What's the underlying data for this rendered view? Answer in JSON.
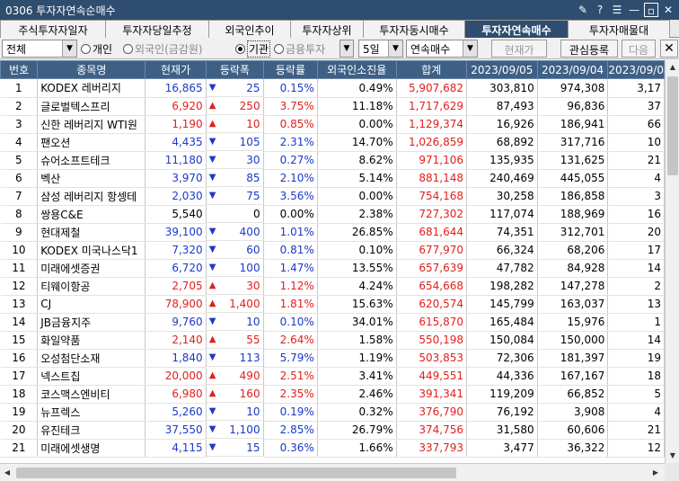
{
  "window": {
    "title": "0306 투자자연속순매수"
  },
  "tabs": [
    {
      "label": "주식투자자일자"
    },
    {
      "label": "투자자당일추정"
    },
    {
      "label": "외국인추이"
    },
    {
      "label": "투자자상위"
    },
    {
      "label": "투자자동시매수"
    },
    {
      "label": "투자자연속매수",
      "active": true
    },
    {
      "label": "투자자매물대"
    }
  ],
  "toolbar": {
    "market_select": "전체",
    "radio_individual": "개인",
    "radio_foreign": "외국인(금감원)",
    "radio_institution": "기관",
    "radio_financial": "금융투자",
    "period_select": "5일",
    "mode_select": "연속매수",
    "price_button": "현재가",
    "watch_button": "관심등록",
    "next_button": "다음",
    "close_button": "✕"
  },
  "colors": {
    "header_bg": "#3f6085",
    "up": "#e0201c",
    "down": "#1a39c9",
    "title_bg": "#2f4d6e"
  },
  "table": {
    "headers": [
      "번호",
      "종목명",
      "현재가",
      "등락폭",
      "등락률",
      "외국인소진율",
      "합계",
      "2023/09/05",
      "2023/09/04",
      "2023/09/0"
    ],
    "rows": [
      [
        "1",
        "KODEX 레버리지",
        "16,865",
        "down",
        "25",
        "0.15%",
        "0.49%",
        "5,907,682",
        "303,810",
        "974,308",
        "3,17"
      ],
      [
        "2",
        "글로벌텍스프리",
        "6,920",
        "up",
        "250",
        "3.75%",
        "11.18%",
        "1,717,629",
        "87,493",
        "96,836",
        "37"
      ],
      [
        "3",
        "신한 레버리지 WTI원",
        "1,190",
        "up",
        "10",
        "0.85%",
        "0.00%",
        "1,129,374",
        "16,926",
        "186,941",
        "66"
      ],
      [
        "4",
        "팬오션",
        "4,435",
        "down",
        "105",
        "2.31%",
        "14.70%",
        "1,026,859",
        "68,892",
        "317,716",
        "10"
      ],
      [
        "5",
        "슈어소프트테크",
        "11,180",
        "down",
        "30",
        "0.27%",
        "8.62%",
        "971,106",
        "135,935",
        "131,625",
        "21"
      ],
      [
        "6",
        "벡산",
        "3,970",
        "down",
        "85",
        "2.10%",
        "5.14%",
        "881,148",
        "240,469",
        "445,055",
        "4"
      ],
      [
        "7",
        "삼성 레버리지 항셍테",
        "2,030",
        "down",
        "75",
        "3.56%",
        "0.00%",
        "754,168",
        "30,258",
        "186,858",
        "3"
      ],
      [
        "8",
        "쌍용C&E",
        "5,540",
        "",
        "0",
        "0.00%",
        "2.38%",
        "727,302",
        "117,074",
        "188,969",
        "16"
      ],
      [
        "9",
        "현대제철",
        "39,100",
        "down",
        "400",
        "1.01%",
        "26.85%",
        "681,644",
        "74,351",
        "312,701",
        "20"
      ],
      [
        "10",
        "KODEX 미국나스닥1",
        "7,320",
        "down",
        "60",
        "0.81%",
        "0.10%",
        "677,970",
        "66,324",
        "68,206",
        "17"
      ],
      [
        "11",
        "미래에셋증권",
        "6,720",
        "down",
        "100",
        "1.47%",
        "13.55%",
        "657,639",
        "47,782",
        "84,928",
        "14"
      ],
      [
        "12",
        "티웨이항공",
        "2,705",
        "up",
        "30",
        "1.12%",
        "4.24%",
        "654,668",
        "198,282",
        "147,278",
        "2"
      ],
      [
        "13",
        "CJ",
        "78,900",
        "up",
        "1,400",
        "1.81%",
        "15.63%",
        "620,574",
        "145,799",
        "163,037",
        "13"
      ],
      [
        "14",
        "JB금융지주",
        "9,760",
        "down",
        "10",
        "0.10%",
        "34.01%",
        "615,870",
        "165,484",
        "15,976",
        "1"
      ],
      [
        "15",
        "화일약품",
        "2,140",
        "up",
        "55",
        "2.64%",
        "1.58%",
        "550,198",
        "150,084",
        "150,000",
        "14"
      ],
      [
        "16",
        "오성첨단소재",
        "1,840",
        "down",
        "113",
        "5.79%",
        "1.19%",
        "503,853",
        "72,306",
        "181,397",
        "19"
      ],
      [
        "17",
        "넥스트칩",
        "20,000",
        "up",
        "490",
        "2.51%",
        "3.41%",
        "449,551",
        "44,336",
        "167,167",
        "18"
      ],
      [
        "18",
        "코스맥스엔비티",
        "6,980",
        "up",
        "160",
        "2.35%",
        "2.46%",
        "391,341",
        "119,209",
        "66,852",
        "5"
      ],
      [
        "19",
        "뉴프렉스",
        "5,260",
        "down",
        "10",
        "0.19%",
        "0.32%",
        "376,790",
        "76,192",
        "3,908",
        "4"
      ],
      [
        "20",
        "유진테크",
        "37,550",
        "down",
        "1,100",
        "2.85%",
        "26.79%",
        "374,756",
        "31,580",
        "60,606",
        "21"
      ],
      [
        "21",
        "미래에셋생명",
        "4,115",
        "down",
        "15",
        "0.36%",
        "1.66%",
        "337,793",
        "3,477",
        "36,322",
        "12"
      ]
    ]
  }
}
